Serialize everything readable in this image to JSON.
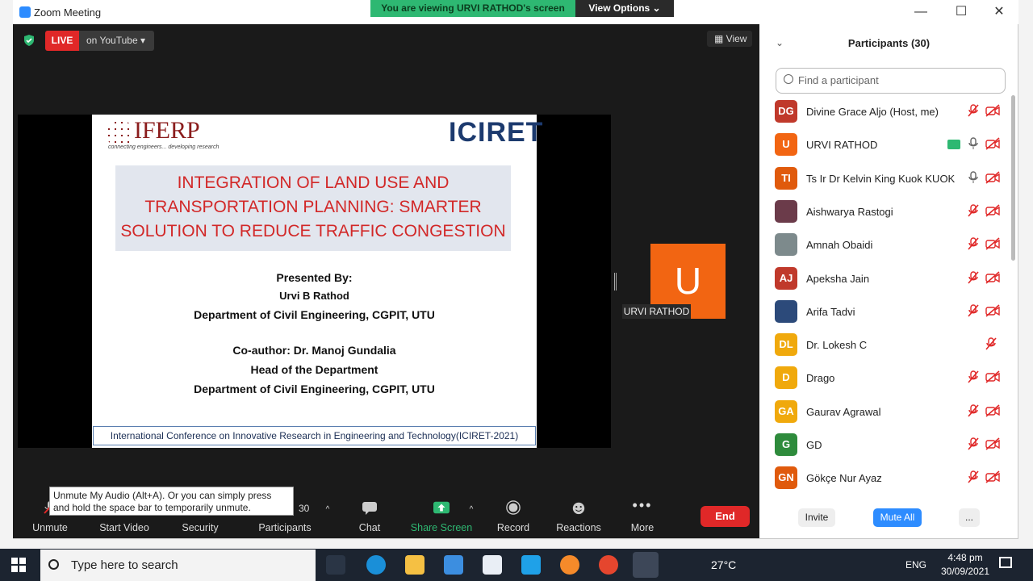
{
  "window": {
    "title": "Zoom Meeting",
    "min": "—",
    "max": "☐",
    "close": "✕"
  },
  "share_banner": {
    "text": "You are viewing URVI RATHOD's screen",
    "view_options": "View Options ⌄"
  },
  "live": {
    "badge": "LIVE",
    "destination": "on YouTube ▾"
  },
  "view_button": "View",
  "slide": {
    "logo_text": "IFERP",
    "logo_tag": "connecting engineers... developing research",
    "conf_logo": "ICIRET",
    "title_lines": [
      "INTEGRATION OF LAND USE AND",
      "TRANSPORTATION PLANNING: SMARTER",
      "SOLUTION TO REDUCE TRAFFIC CONGESTION"
    ],
    "presented_by": "Presented By:",
    "presenter": "Urvi B Rathod",
    "dept1": "Department of Civil Engineering, CGPIT, UTU",
    "coauthor": "Co-author: Dr. Manoj Gundalia",
    "role": "Head of the Department",
    "dept2": "Department of Civil Engineering, CGPIT, UTU",
    "footer": "International Conference on Innovative Research in Engineering and Technology(ICIRET-2021)"
  },
  "video_tile": {
    "initial": "U",
    "name": "URVI RATHOD"
  },
  "toolbar": {
    "unmute": "Unmute",
    "start_video": "Start Video",
    "security": "Security",
    "participants": "Participants",
    "participant_count": "30",
    "chat": "Chat",
    "share_screen": "Share Screen",
    "record": "Record",
    "reactions": "Reactions",
    "more": "More",
    "end": "End"
  },
  "tooltip": "Unmute My Audio (Alt+A). Or you can simply press and hold the space bar to temporarily unmute.",
  "panel": {
    "title": "Participants (30)",
    "search_placeholder": "Find a participant",
    "participants": [
      {
        "initials": "DG",
        "name": "Divine Grace Aljo (Host, me)",
        "color": "#c0392b"
      },
      {
        "initials": "U",
        "name": "URVI RATHOD",
        "color": "#f26512"
      },
      {
        "initials": "TI",
        "name": "Ts Ir Dr Kelvin King Kuok KUOK",
        "color": "#e05a0c"
      },
      {
        "initials": "",
        "name": "Aishwarya Rastogi",
        "color": "#6b3b4a"
      },
      {
        "initials": "",
        "name": "Amnah Obaidi",
        "color": "#7d8a8c"
      },
      {
        "initials": "AJ",
        "name": "Apeksha Jain",
        "color": "#c0392b"
      },
      {
        "initials": "",
        "name": "Arifa Tadvi",
        "color": "#2c4a7a"
      },
      {
        "initials": "DL",
        "name": "Dr. Lokesh C",
        "color": "#f0a90c"
      },
      {
        "initials": "D",
        "name": "Drago",
        "color": "#f0a90c"
      },
      {
        "initials": "GA",
        "name": "Gaurav Agrawal",
        "color": "#f0a90c"
      },
      {
        "initials": "G",
        "name": "GD",
        "color": "#2e8b3c"
      },
      {
        "initials": "GN",
        "name": "Gökçe Nur Ayaz",
        "color": "#e05a0c"
      }
    ],
    "invite": "Invite",
    "mute_all": "Mute All",
    "more": "..."
  },
  "taskbar": {
    "search_placeholder": "Type here to search",
    "temperature": "27°C",
    "language": "ENG",
    "time": "4:48 pm",
    "date": "30/09/2021"
  },
  "colors": {
    "accent": "#2d8cff",
    "live": "#e02828",
    "end": "#e02828",
    "share": "#2eb872"
  }
}
